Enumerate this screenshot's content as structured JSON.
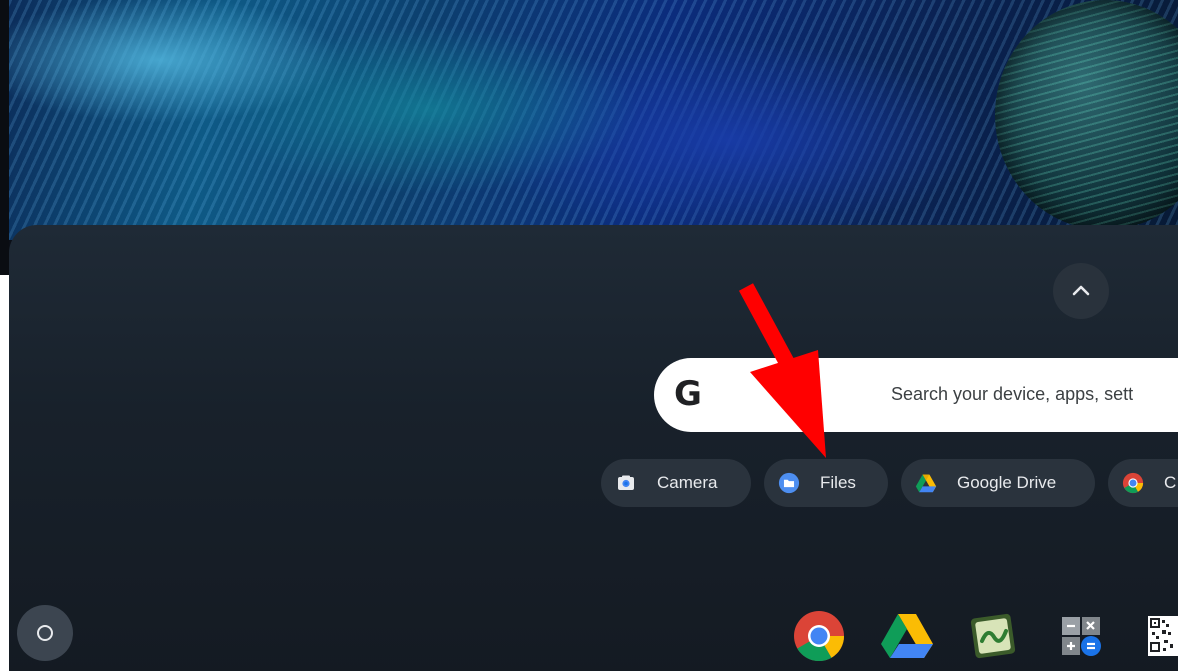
{
  "launcher": {
    "search": {
      "logo": "G",
      "placeholder": "Search your device, apps, sett"
    },
    "collapse_icon": "chevron-up-icon",
    "suggestion_chips": [
      {
        "label": "Camera",
        "icon": "camera-icon"
      },
      {
        "label": "Files",
        "icon": "folder-icon"
      },
      {
        "label": "Google Drive",
        "icon": "google-drive-icon"
      },
      {
        "label": "C",
        "icon": "chrome-icon"
      }
    ]
  },
  "annotation": {
    "color": "#ff0000",
    "icon": "red-arrow-icon"
  },
  "shelf": {
    "launcher_icon": "launcher-circle-icon",
    "apps": [
      {
        "icon": "chrome-icon"
      },
      {
        "icon": "google-drive-icon"
      },
      {
        "icon": "green-app-icon"
      },
      {
        "icon": "calculator-icon"
      },
      {
        "icon": "qr-code-icon"
      }
    ]
  },
  "colors": {
    "chip_bg": "#2a333d",
    "panel_bg": "#18212b",
    "search_bg": "#ffffff"
  }
}
